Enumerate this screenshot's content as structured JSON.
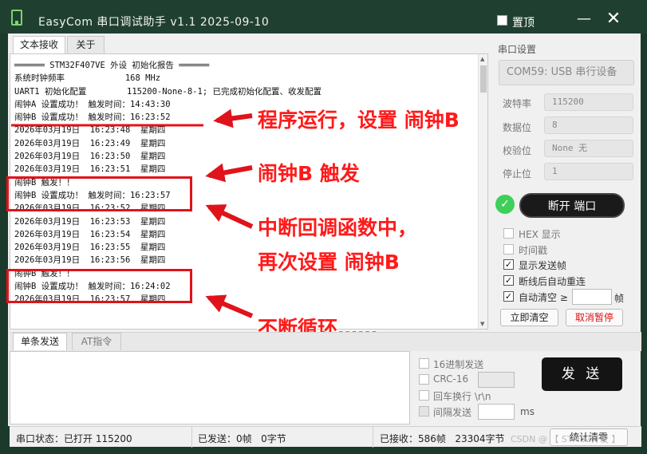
{
  "window": {
    "title": "EasyCom 串口调试助手 v1.1    2025-09-10",
    "pin_label": "置顶",
    "minimize_glyph": "—",
    "close_glyph": "✕"
  },
  "receive_tabs": [
    "文本接收",
    "关于"
  ],
  "receive_lines": [
    "══════ STM32F407VE 外设 初始化报告 ══════",
    "系统时钟频率            168 MHz",
    "UART1 初始化配置        115200-None-8-1; 已完成初始化配置、收发配置",
    "闹钟A 设置成功！ 触发时间：14:43:30",
    "闹钟B 设置成功！ 触发时间：16:23:52",
    "2026年03月19日  16:23:48  星期四",
    "2026年03月19日  16:23:49  星期四",
    "2026年03月19日  16:23:50  星期四",
    "2026年03月19日  16:23:51  星期四",
    "闹钟B 触发！！",
    "闹钟B 设置成功！ 触发时间：16:23:57",
    "2026年03月19日  16:23:52  星期四",
    "2026年03月19日  16:23:53  星期四",
    "2026年03月19日  16:23:54  星期四",
    "2026年03月19日  16:23:55  星期四",
    "2026年03月19日  16:23:56  星期四",
    "闹钟B 触发！！",
    "闹钟B 设置成功！ 触发时间：16:24:02",
    "2026年03月19日  16:23:57  星期四"
  ],
  "annotations": {
    "a1": "程序运行，设置 闹钟B",
    "a2": "闹钟B 触发",
    "a3_line1": "中断回调函数中，",
    "a3_line2": "再次设置 闹钟B",
    "a4": "不断循环……"
  },
  "serial": {
    "section_title": "串口设置",
    "port": "COM59: USB 串行设备",
    "params": [
      {
        "label": "波特率",
        "value": "115200"
      },
      {
        "label": "数据位",
        "value": "8"
      },
      {
        "label": "校验位",
        "value": "None  无"
      },
      {
        "label": "停止位",
        "value": "1"
      }
    ],
    "connected_glyph": "✓",
    "open_button": "断开 端口",
    "options": [
      {
        "label": "HEX 显示",
        "checked": false
      },
      {
        "label": "时间戳",
        "checked": false
      },
      {
        "label": "显示发送帧",
        "checked": true
      },
      {
        "label": "断线后自动重连",
        "checked": true
      },
      {
        "label": "自动清空 ≥",
        "checked": true
      }
    ],
    "clear_unit": "帧",
    "clear_now": "立即清空",
    "cancel_pause": "取消暂停"
  },
  "send": {
    "tabs": [
      "单条发送",
      "AT指令"
    ],
    "options": [
      "16进制发送",
      "CRC-16",
      "回车换行 \\r\\n",
      "间隔发送"
    ],
    "interval_unit": "ms",
    "send_button": "发 送"
  },
  "status": {
    "port_state": "串口状态：已打开 115200",
    "sent": "已发送：0帧   0字节",
    "received": "已接收：586帧   23304字节",
    "reset_button": "统计清零",
    "watermark": "CSDN @ 【 STM32开发 】"
  },
  "colors": {
    "accent_red": "#e0131b",
    "titlebar_bg": "#1f4030",
    "connected_green": "#3ecf5a"
  }
}
